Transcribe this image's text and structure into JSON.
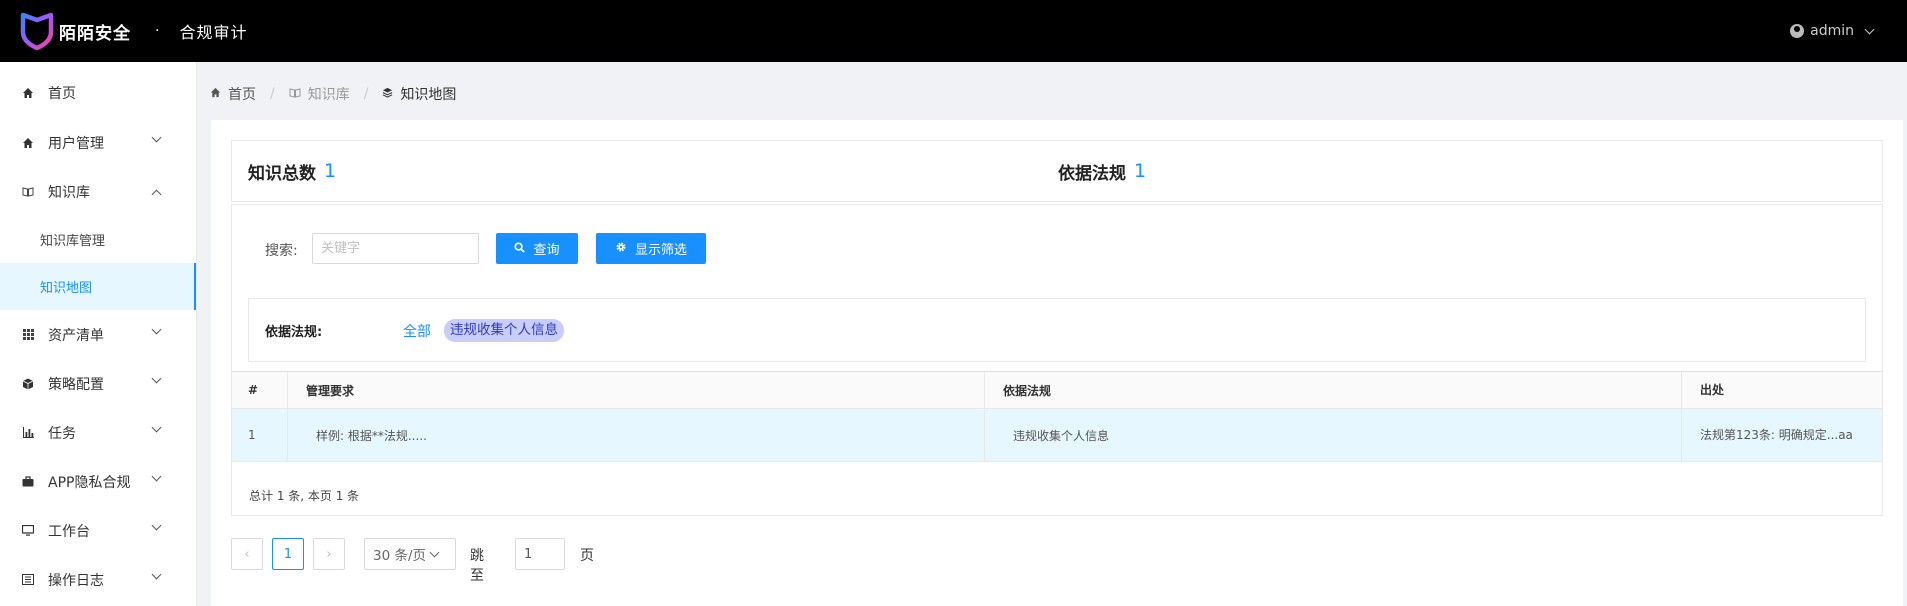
{
  "header": {
    "brand": "陌陌安全",
    "separator": "·",
    "subtitle": "合规审计",
    "user": "admin",
    "colors": {
      "background": "#000000",
      "logo_gradient": [
        "#3b82f6",
        "#a855f7",
        "#ec4899"
      ]
    }
  },
  "sidebar": {
    "items": [
      {
        "label": "首页",
        "icon": "home-icon"
      },
      {
        "label": "用户管理",
        "icon": "home-icon"
      },
      {
        "label": "知识库",
        "icon": "book-icon"
      },
      {
        "label": "资产清单",
        "icon": "grid-icon"
      },
      {
        "label": "策略配置",
        "icon": "cube-icon"
      },
      {
        "label": "任务",
        "icon": "bar-chart-icon"
      },
      {
        "label": "APP隐私合规",
        "icon": "briefcase-icon"
      },
      {
        "label": "工作台",
        "icon": "monitor-icon"
      },
      {
        "label": "操作日志",
        "icon": "log-icon"
      }
    ],
    "knowledge_sub": [
      {
        "label": "知识库管理"
      },
      {
        "label": "知识地图"
      }
    ]
  },
  "breadcrumb": {
    "home": "首页",
    "knowledge": "知识库",
    "current": "知识地图"
  },
  "stats": {
    "total_label": "知识总数",
    "total_value": "1",
    "law_label": "依据法规",
    "law_value": "1"
  },
  "search": {
    "label": "搜索:",
    "placeholder": "关键字",
    "query_button": "查询",
    "filter_button": "显示筛选"
  },
  "filter": {
    "label": "依据法规:",
    "all": "全部",
    "tag": "违规收集个人信息"
  },
  "table": {
    "columns": [
      "#",
      "管理要求",
      "依据法规",
      "出处"
    ],
    "rows": [
      {
        "index": "1",
        "requirement": "样例: 根据**法规.....",
        "law": "违规收集个人信息",
        "source": "法规第123条: 明确规定...aa"
      }
    ],
    "summary": "总计 1 条, 本页 1 条"
  },
  "pagination": {
    "prev": "‹",
    "current": "1",
    "next": "›",
    "page_size": "30 条/页",
    "goto_label": "跳至",
    "goto_value": "1",
    "page_label": "页"
  },
  "accent_color": "#1890ff"
}
